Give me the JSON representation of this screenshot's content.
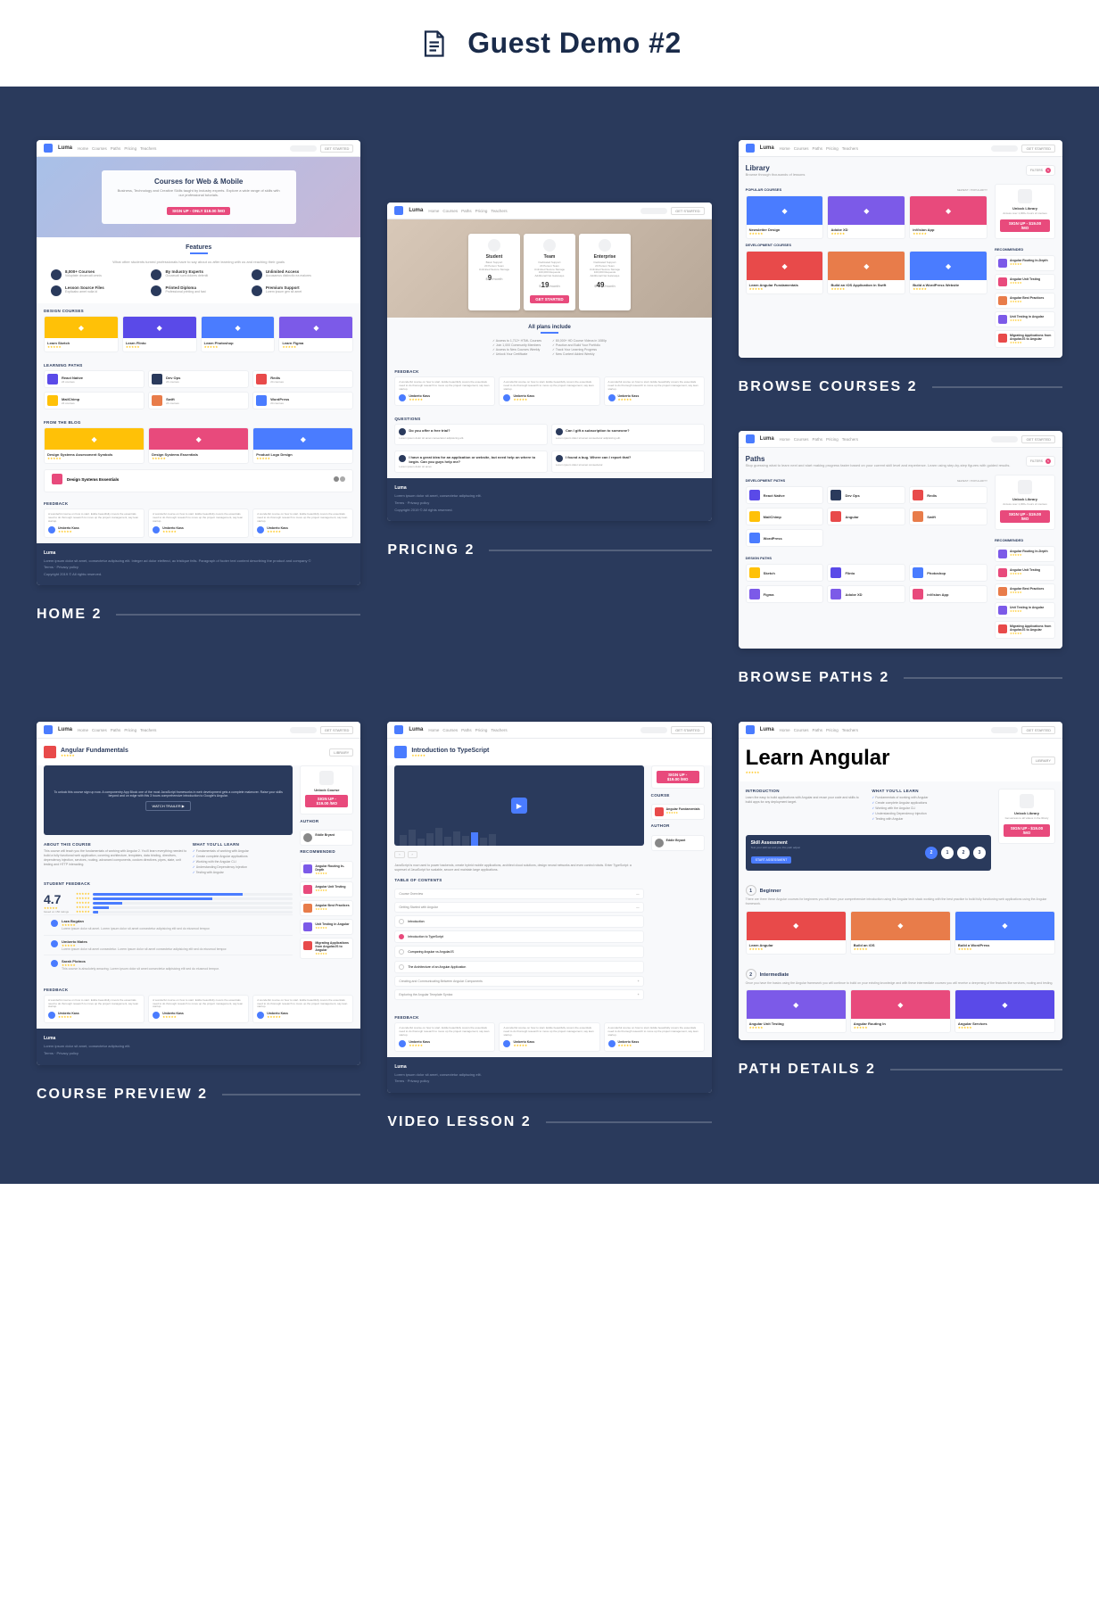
{
  "header": {
    "title": "Guest Demo #2"
  },
  "nav": {
    "brand": "Luma",
    "links": [
      "Home",
      "Courses",
      "Paths",
      "Pricing",
      "Teachers"
    ],
    "cta": "GET STARTED"
  },
  "captions": {
    "home": "HOME 2",
    "pricing": "PRICING 2",
    "browse_courses": "BROWSE COURSES 2",
    "browse_paths": "BROWSE PATHS 2",
    "course_preview": "COURSE PREVIEW 2",
    "video_lesson": "VIDEO LESSON 2",
    "path_details": "PATH DETAILS 2"
  },
  "home": {
    "hero_title": "Courses for Web & Mobile",
    "hero_sub": "Business, Technology and Creative Skills taught by industry experts. Explore a wide range of skills with our professional tutorials.",
    "hero_cta": "SIGN UP - ONLY $19.00 /MO",
    "features_title": "Features",
    "features_sub": "What other students turned professionals have to say about us after learning with us and reaching their goals",
    "features": [
      {
        "t": "8,000+ Courses",
        "s": "Voluptate obcaecati omnis"
      },
      {
        "t": "By Industry Experts",
        "s": "Occaecati sunt dolores deleniti"
      },
      {
        "t": "Unlimited Access",
        "s": "Accusamus distinctio ea maiores"
      },
      {
        "t": "Lesson Source Files",
        "s": "Explicabo amet nulla id"
      },
      {
        "t": "Printed Diploma",
        "s": "Professional printing and fast"
      },
      {
        "t": "Premium Support",
        "s": "Lorem ipsum gen sit amet"
      }
    ],
    "design_label": "DESIGN COURSES",
    "design_courses": [
      {
        "t": "Learn Sketch",
        "c": "#ffc107"
      },
      {
        "t": "Learn Flinto",
        "c": "#5a4ae8"
      },
      {
        "t": "Learn Photoshop",
        "c": "#4a7cff"
      },
      {
        "t": "Learn Figma",
        "c": "#7c5ae8"
      }
    ],
    "paths_label": "LEARNING PATHS",
    "paths": [
      {
        "t": "React Native",
        "c": "#5a4ae8"
      },
      {
        "t": "Dev Ops",
        "c": "#2a3a5c"
      },
      {
        "t": "Redis",
        "c": "#e84a4a"
      },
      {
        "t": "MailChimp",
        "c": "#ffc107"
      },
      {
        "t": "Swift",
        "c": "#e87c4a"
      },
      {
        "t": "WordPress",
        "c": "#4a7cff"
      }
    ],
    "blog_label": "FROM THE BLOG",
    "blog": [
      {
        "t": "Design Systems Assessment Symbols",
        "c": "#ffc107"
      },
      {
        "t": "Design Systems Essentials",
        "c": "#e84a7c"
      },
      {
        "t": "Product Logo Design",
        "c": "#4a7cff"
      }
    ],
    "blog_feature": "Design Systems Essentials",
    "feedback_label": "FEEDBACK",
    "feedback_author": "Umberto Kass"
  },
  "pricing": {
    "plans": [
      {
        "name": "Student",
        "price": "9",
        "per": "/month",
        "desc": "Basic Support\n20 Person Team\nUnlimited Secure Storage"
      },
      {
        "name": "Team",
        "price": "19",
        "per": "/month",
        "desc": "Dedicated Support\n20 Person Team\nUnlimited Secure Storage\n100,000 Requests\nAdditional Net Gateways",
        "featured": true
      },
      {
        "name": "Enterprise",
        "price": "49",
        "per": "/month",
        "desc": "Dedicated Support\n20 Person Team\nUnlimited Secure Storage\n100,000 Requests\nAdditional Net Gateways"
      }
    ],
    "cta": "GET STARTED",
    "include_title": "All plans include",
    "includes": [
      [
        "Access to 1,712+ HTML Courses",
        "Join 1,000 Community Members",
        "Access to New Courses Weekly",
        "Unlock Your Certificate"
      ],
      [
        "80,000+ HD Course Videos in 1080p",
        "Practice and Build Your Portfolio",
        "Track Your Learning Progress",
        "New Content Added Weekly"
      ]
    ],
    "feedback_label": "FEEDBACK",
    "feedback_author": "Umberto Kass",
    "questions_label": "QUESTIONS",
    "questions": [
      {
        "q": "Do you offer a free trial?",
        "a": "Lorem ipsum dolor sit amet consectetur adipisicing elit."
      },
      {
        "q": "Can I gift a subscription to someone?",
        "a": "Lorem ipsum dolor sit amet consectetur adipisicing elit."
      },
      {
        "q": "I have a great idea for an application or website, but need help on where to begin. Can you guys help me?",
        "a": "Lorem ipsum dolor sit amet."
      },
      {
        "q": "I found a bug. Where can I report that?",
        "a": "Lorem ipsum dolor sit amet consectetur."
      }
    ]
  },
  "browse_courses": {
    "title": "Library",
    "sub": "Browse through thousands of lessons",
    "filters": "FILTERS",
    "filter_count": "5",
    "popular_label": "POPULAR COURSES",
    "sort": "NEWEST / POPULARITY",
    "popular": [
      {
        "t": "Newsletter Design",
        "c": "#4a7cff"
      },
      {
        "t": "Adobe XD",
        "c": "#7c5ae8"
      },
      {
        "t": "inVision App",
        "c": "#e84a7c"
      }
    ],
    "dev_label": "DEVELOPMENT COURSES",
    "dev": [
      {
        "t": "Learn Angular Fundamentals",
        "c": "#e84a4a"
      },
      {
        "t": "Build an iOS Application in Swift",
        "c": "#e87c4a"
      },
      {
        "t": "Build a WordPress Website",
        "c": "#4a7cff"
      }
    ],
    "side_title": "Unlock Library",
    "side_sub": "Access over 1,000+ hours of courses",
    "side_cta": "SIGN UP - $19.00 /MO",
    "rec_label": "RECOMMENDED",
    "rec": [
      {
        "t": "Angular Routing In-Depth",
        "c": "#7c5ae8"
      },
      {
        "t": "Angular Unit Testing",
        "c": "#e84a7c"
      },
      {
        "t": "Angular Best Practices",
        "c": "#e87c4a"
      },
      {
        "t": "Unit Testing in Angular",
        "c": "#7c5ae8"
      },
      {
        "t": "Migrating Applications from AngularJS to Angular",
        "c": "#e84a4a"
      }
    ]
  },
  "browse_paths": {
    "title": "Paths",
    "sub": "Stop guessing what to learn next and start making progress faster based on your current skill level and experience. Learn using step-by-step figures with guided results.",
    "dev_label": "DEVELOPMENT PATHS",
    "dev": [
      {
        "t": "React Native",
        "c": "#5a4ae8"
      },
      {
        "t": "Dev Ops",
        "c": "#2a3a5c"
      },
      {
        "t": "Redis",
        "c": "#e84a4a"
      },
      {
        "t": "MailChimp",
        "c": "#ffc107"
      },
      {
        "t": "Angular",
        "c": "#e84a4a"
      },
      {
        "t": "Swift",
        "c": "#e87c4a"
      },
      {
        "t": "WordPress",
        "c": "#4a7cff"
      }
    ],
    "design_label": "DESIGN PATHS",
    "design": [
      {
        "t": "Sketch",
        "c": "#ffc107"
      },
      {
        "t": "Flinto",
        "c": "#5a4ae8"
      },
      {
        "t": "Photoshop",
        "c": "#4a7cff"
      },
      {
        "t": "Figma",
        "c": "#7c5ae8"
      },
      {
        "t": "Adobe XD",
        "c": "#7c5ae8"
      },
      {
        "t": "inVision App",
        "c": "#e84a7c"
      }
    ],
    "side_title": "Unlock Library",
    "side_cta": "SIGN UP - $19.00 /MO",
    "rec_label": "RECOMMENDED"
  },
  "course_preview": {
    "title": "Angular Fundamentals",
    "icon_color": "#e84a4a",
    "library_btn": "LIBRARY",
    "preview_text": "To unlock this course sign up now. A componentry App Block one of the most JavaScript frameworks in web development gets a complete makeover. Raise your skills beyond and on edge with this 3 hours comprehensive introduction to Google's Angular.",
    "trailer_btn": "WATCH TRAILER ▶",
    "about_label": "ABOUT THIS COURSE",
    "about": "This course will teach you the fundamentals of working with Angular 2. You'll learn everything needed to build a fully functional web application, covering architecture, templates, data binding, directives, dependency injection, services, routing, advanced components, custom directives, pipes, state, unit testing and HTTP interacting.",
    "learn_label": "WHAT YOU'LL LEARN",
    "learn": [
      "Fundamentals of working with Angular",
      "Create complete Angular applications",
      "Working with the Angular CLI",
      "Understanding Dependency Injection",
      "Testing with Angular"
    ],
    "side_title": "Unlock Course",
    "side_cta": "SIGN UP - $19.00 /MO",
    "author_label": "AUTHOR",
    "author": "Eddie Bryant",
    "rec_label": "RECOMMENDED",
    "rec": [
      "Angular Routing In-Depth",
      "Angular Unit Testing",
      "Angular Best Practices",
      "Unit Testing in Angular",
      "Migrating Applications from AngularJS to Angular"
    ],
    "feedback_label": "STUDENT FEEDBACK",
    "rating": "4.7",
    "rating_sub": "based on 150 ratings",
    "reviews": [
      {
        "n": "Laza Bogdan",
        "t": "Lorem ipsum dolor sit amet."
      },
      {
        "n": "Umberto Mates",
        "t": "Lorem ipsum dolor sit amet consectetur."
      },
      {
        "n": "Sarah Plotnos",
        "t": "This course is absolutely amazing."
      }
    ]
  },
  "video_lesson": {
    "title": "Introduction to TypeScript",
    "icon_color": "#4a7cff",
    "desc": "JavaScript is now used to power backends, create hybrid mobile applications, architect cloud solutions, design neural networks and even control robots. Enter TypeScript: a superset of JavaScript for scalable, secure and maintain large applications.",
    "toc_label": "TABLE OF CONTENTS",
    "toc_head": "Course Overview",
    "sections": [
      {
        "h": "Getting Started with Angular",
        "items": [
          "Introduction",
          "Introduction to TypeScript",
          "Comparing Angular vs AngularJS",
          "The Architecture of an Angular Application"
        ]
      },
      {
        "h": "Creating and Communicating Between Angular Components",
        "items": []
      },
      {
        "h": "Exploring the Angular Template Syntax",
        "items": []
      }
    ],
    "course_label": "COURSE",
    "course_name": "Angular Fundamentals",
    "author_label": "AUTHOR",
    "author": "Eddie Bryant",
    "side_cta": "SIGN UP - $19.00 /MO",
    "feedback_label": "FEEDBACK",
    "feedback_author": "Umberto Kass"
  },
  "path_details": {
    "title": "Learn Angular",
    "library_btn": "LIBRARY",
    "intro_label": "INTRODUCTION",
    "intro": "Learn the easy to build applications with Angular and reuse your code and skills to build apps for any deployment target.",
    "learn_label": "WHAT YOU'LL LEARN",
    "learn": [
      "Fundamentals of working with Angular",
      "Create complete Angular applications",
      "Working with the Angular CLI",
      "Understanding Dependency Injection",
      "Testing with Angular"
    ],
    "side_title": "Unlock Library",
    "side_sub": "Get access to all videos in the library",
    "side_cta": "SIGN UP - $19.00 /MO",
    "skill_title": "Skill Assessment",
    "skill_sub": "Test your skill set and you this path adjust",
    "skill_cta": "START ASSESSMENT",
    "steps": [
      "2",
      "1",
      "2",
      "3"
    ],
    "levels": [
      {
        "n": "1",
        "t": "Beginner",
        "d": "There are three these Angular courses for beginners you will learn your comprehensive introduction using the Angular tech stack working with the best practice to build fully functioning web applications using the Angular framework.",
        "courses": [
          {
            "t": "Learn Angular",
            "c": "#e84a4a"
          },
          {
            "t": "Build an iOS",
            "c": "#e87c4a"
          },
          {
            "t": "Build a WordPress",
            "c": "#4a7cff"
          }
        ]
      },
      {
        "n": "2",
        "t": "Intermediate",
        "d": "Once you have the basics using the Angular framework you will continue to build on your existing knowledge and with these intermediate courses you will receive a deepening of the features like services, routing and testing.",
        "courses": [
          {
            "t": "Angular Unit Testing",
            "c": "#7c5ae8"
          },
          {
            "t": "Angular Routing In",
            "c": "#e84a7c"
          },
          {
            "t": "Angular Services",
            "c": "#5a4ae8"
          }
        ]
      }
    ]
  }
}
